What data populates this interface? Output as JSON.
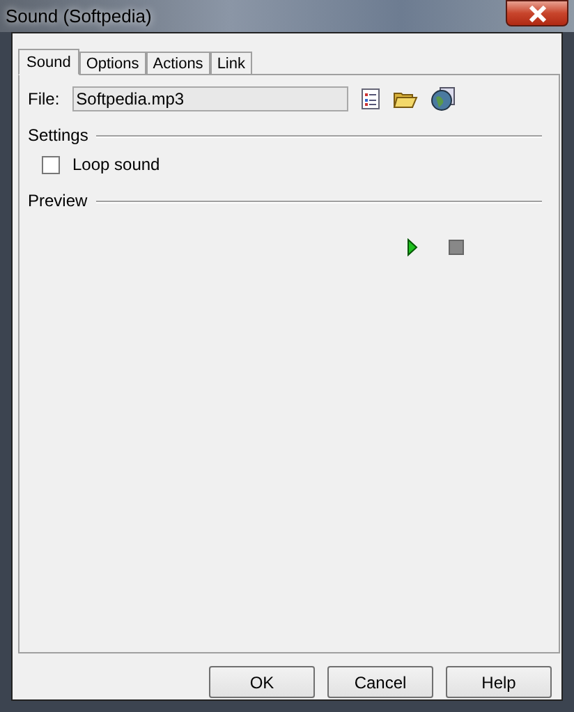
{
  "window": {
    "title": "Sound (Softpedia)"
  },
  "tabs": [
    {
      "label": "Sound",
      "selected": true
    },
    {
      "label": "Options",
      "selected": false
    },
    {
      "label": "Actions",
      "selected": false
    },
    {
      "label": "Link",
      "selected": false
    }
  ],
  "file": {
    "label": "File:",
    "value": "Softpedia.mp3"
  },
  "settings": {
    "title": "Settings",
    "checkbox": {
      "label": "Loop sound",
      "checked": false
    }
  },
  "preview": {
    "title": "Preview"
  },
  "buttons": [
    "OK",
    "Cancel",
    "Help"
  ]
}
